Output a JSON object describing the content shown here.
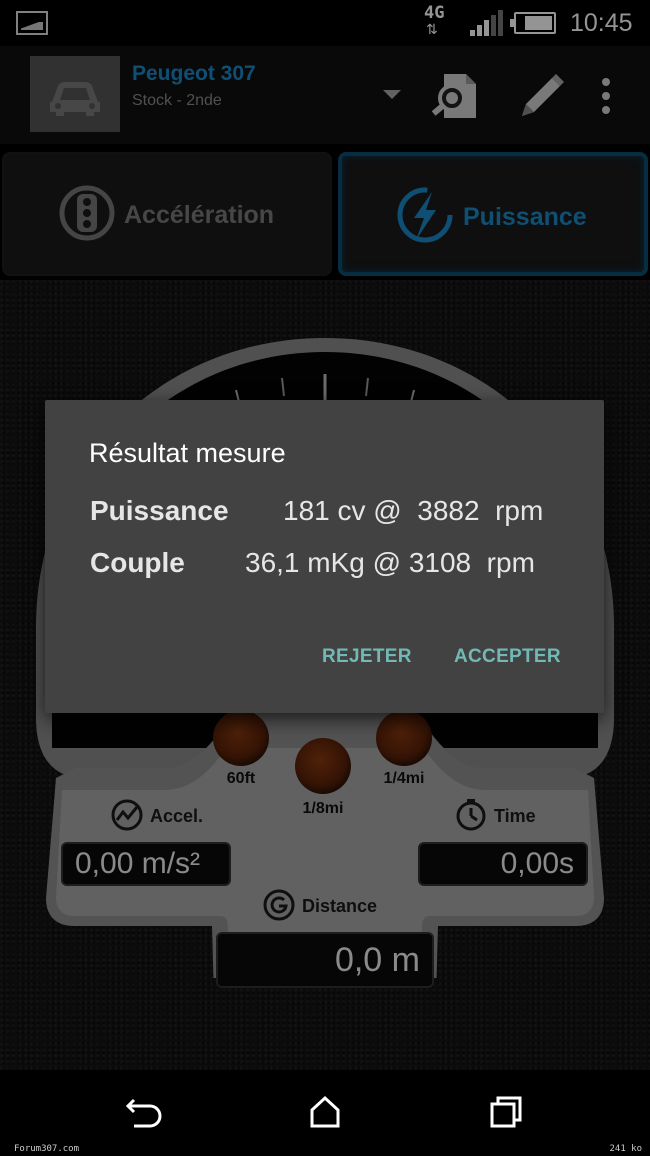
{
  "status_bar": {
    "network": "4G",
    "network_arrows": "⇅",
    "time": "10:45"
  },
  "header": {
    "car_name": "Peugeot 307",
    "car_config": "Stock - 2nde",
    "icons": [
      "car-icon",
      "dropdown-icon",
      "search-document-icon",
      "pencil-icon",
      "overflow-menu-icon"
    ]
  },
  "tabs": [
    {
      "label": "Accélération",
      "icon": "traffic-light-icon",
      "active": false
    },
    {
      "label": "Puissance",
      "icon": "lightning-icon",
      "active": true
    }
  ],
  "gauge": {
    "lights": [
      {
        "label": "60ft"
      },
      {
        "label": "1/8mi"
      },
      {
        "label": "1/4mi"
      }
    ],
    "accel": {
      "label": "Accel.",
      "value": "0,00 m/s²"
    },
    "time": {
      "label": "Time",
      "value": "0,00s"
    },
    "distance": {
      "label": "Distance",
      "value": "0,0 m"
    }
  },
  "dialog": {
    "title": "Résultat mesure",
    "rows": [
      {
        "label": "Puissance",
        "value": "181 cv @  3882  rpm"
      },
      {
        "label": "Couple",
        "value": "36,1 mKg @ 3108  rpm"
      }
    ],
    "reject_label": "REJETER",
    "accept_label": "ACCEPTER"
  },
  "nav_bar": {
    "icons": [
      "back-icon",
      "home-icon",
      "recents-icon"
    ]
  },
  "footer": {
    "left": "Forum307.com",
    "right": "241 ko"
  },
  "colors": {
    "accent_blue": "#1a89c9",
    "dialog_bg": "#424242",
    "dialog_button": "#72b9b5",
    "active_tab_border": "#0d4f72"
  }
}
